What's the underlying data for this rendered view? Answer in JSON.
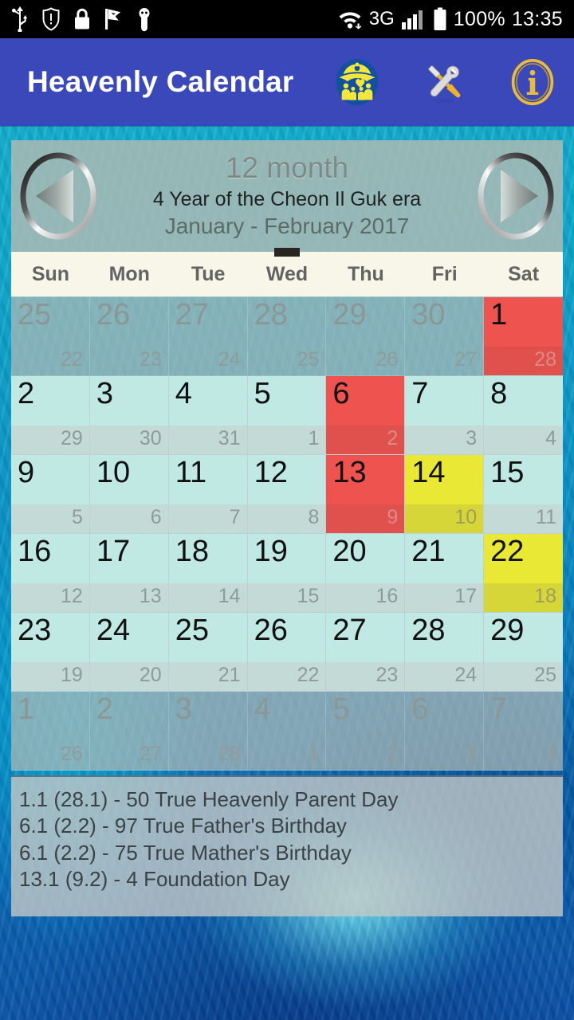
{
  "status_bar": {
    "left_icons": [
      "usb-icon",
      "shield-alert-icon",
      "lock-icon",
      "check-flag-icon",
      "android-debug-icon"
    ],
    "wifi_icon": "wifi-icon",
    "network_type": "3G",
    "signal_icon": "signal-bars-icon",
    "battery_icon": "battery-full-icon",
    "battery_percent": "100%",
    "clock": "13:35"
  },
  "app_bar": {
    "title": "Heavenly Calendar",
    "logo_icon": "family-logo-icon",
    "settings_icon": "tools-icon",
    "info_icon": "info-circle-icon",
    "background_color": "#3a48ba"
  },
  "month_panel": {
    "prev_icon": "previous-arrow-icon",
    "next_icon": "next-arrow-icon",
    "month_number": "12 month",
    "era_line": "4 Year of the Cheon Il Guk era",
    "range_line": "January - February 2017"
  },
  "weekdays": [
    "Sun",
    "Mon",
    "Tue",
    "Wed",
    "Thu",
    "Fri",
    "Sat"
  ],
  "colors": {
    "normal_cell": "#c0e9e4",
    "holiday_cell": "#ef5350",
    "event_cell": "#e9e834",
    "outside_month_text": "#8b9794",
    "weekday_header_bg": "#f8f6e9"
  },
  "days": [
    {
      "primary": "25",
      "secondary": "22",
      "state": "out"
    },
    {
      "primary": "26",
      "secondary": "23",
      "state": "out"
    },
    {
      "primary": "27",
      "secondary": "24",
      "state": "out"
    },
    {
      "primary": "28",
      "secondary": "25",
      "state": "out"
    },
    {
      "primary": "29",
      "secondary": "26",
      "state": "out"
    },
    {
      "primary": "30",
      "secondary": "27",
      "state": "out"
    },
    {
      "primary": "1",
      "secondary": "28",
      "state": "red"
    },
    {
      "primary": "2",
      "secondary": "29",
      "state": "normal"
    },
    {
      "primary": "3",
      "secondary": "30",
      "state": "normal"
    },
    {
      "primary": "4",
      "secondary": "31",
      "state": "normal"
    },
    {
      "primary": "5",
      "secondary": "1",
      "state": "normal"
    },
    {
      "primary": "6",
      "secondary": "2",
      "state": "red"
    },
    {
      "primary": "7",
      "secondary": "3",
      "state": "normal"
    },
    {
      "primary": "8",
      "secondary": "4",
      "state": "normal"
    },
    {
      "primary": "9",
      "secondary": "5",
      "state": "normal"
    },
    {
      "primary": "10",
      "secondary": "6",
      "state": "normal"
    },
    {
      "primary": "11",
      "secondary": "7",
      "state": "normal"
    },
    {
      "primary": "12",
      "secondary": "8",
      "state": "normal"
    },
    {
      "primary": "13",
      "secondary": "9",
      "state": "red"
    },
    {
      "primary": "14",
      "secondary": "10",
      "state": "yellow"
    },
    {
      "primary": "15",
      "secondary": "11",
      "state": "normal"
    },
    {
      "primary": "16",
      "secondary": "12",
      "state": "normal"
    },
    {
      "primary": "17",
      "secondary": "13",
      "state": "normal"
    },
    {
      "primary": "18",
      "secondary": "14",
      "state": "normal"
    },
    {
      "primary": "19",
      "secondary": "15",
      "state": "normal"
    },
    {
      "primary": "20",
      "secondary": "16",
      "state": "normal"
    },
    {
      "primary": "21",
      "secondary": "17",
      "state": "normal"
    },
    {
      "primary": "22",
      "secondary": "18",
      "state": "yellow"
    },
    {
      "primary": "23",
      "secondary": "19",
      "state": "normal"
    },
    {
      "primary": "24",
      "secondary": "20",
      "state": "normal"
    },
    {
      "primary": "25",
      "secondary": "21",
      "state": "normal"
    },
    {
      "primary": "26",
      "secondary": "22",
      "state": "normal"
    },
    {
      "primary": "27",
      "secondary": "23",
      "state": "normal"
    },
    {
      "primary": "28",
      "secondary": "24",
      "state": "normal"
    },
    {
      "primary": "29",
      "secondary": "25",
      "state": "normal"
    },
    {
      "primary": "1",
      "secondary": "26",
      "state": "out"
    },
    {
      "primary": "2",
      "secondary": "27",
      "state": "out"
    },
    {
      "primary": "3",
      "secondary": "28",
      "state": "out"
    },
    {
      "primary": "4",
      "secondary": "1",
      "state": "out"
    },
    {
      "primary": "5",
      "secondary": "2",
      "state": "out"
    },
    {
      "primary": "6",
      "secondary": "3",
      "state": "out"
    },
    {
      "primary": "7",
      "secondary": "4",
      "state": "out"
    }
  ],
  "events": [
    "1.1 (28.1) - 50 True Heavenly Parent Day",
    "6.1 (2.2) - 97 True Father's Birthday",
    "6.1 (2.2) - 75 True Mather's Birthday",
    "13.1 (9.2) - 4 Foundation Day"
  ]
}
